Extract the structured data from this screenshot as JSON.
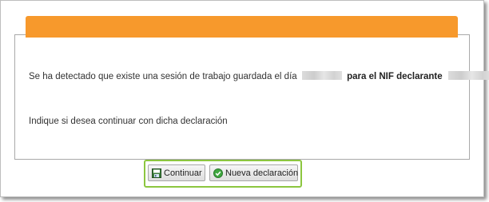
{
  "dialog": {
    "message_prefix": "Se ha detectado que existe una sesión de trabajo guardada el día",
    "message_nif_label": "para el NIF declarante",
    "question": "Indique si desea continuar con dicha declaración"
  },
  "buttons": {
    "continue_label": "Continuar",
    "continue_icon": "save-disk-icon",
    "new_label": "Nueva declaración",
    "new_icon": "check-circle-icon"
  },
  "colors": {
    "header_orange": "#f7992c",
    "highlight_green": "#8cc63f"
  }
}
